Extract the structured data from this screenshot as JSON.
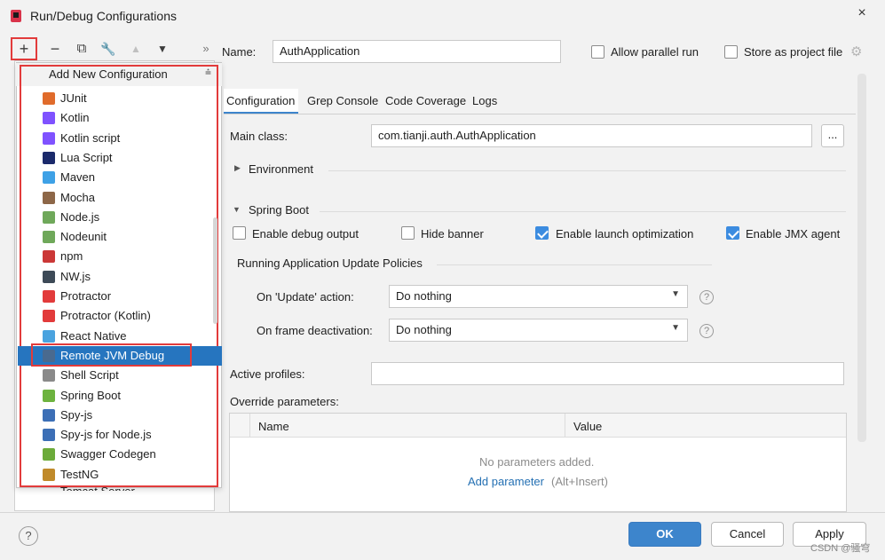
{
  "window": {
    "title": "Run/Debug Configurations",
    "close": "×"
  },
  "toolbar": {
    "add": "+",
    "remove": "−",
    "copy": "⧉",
    "edit": "🔧",
    "up": "▲",
    "down": "▼",
    "more": "»"
  },
  "popup": {
    "header": "Add New Configuration",
    "items": [
      {
        "label": "JUnit",
        "icon": "junit-icon",
        "color": "#e06b2b"
      },
      {
        "label": "Kotlin",
        "icon": "kotlin-icon",
        "color": "#7f52ff"
      },
      {
        "label": "Kotlin script",
        "icon": "kotlin-script-icon",
        "color": "#7f52ff"
      },
      {
        "label": "Lua Script",
        "icon": "lua-icon",
        "color": "#1b2a6b"
      },
      {
        "label": "Maven",
        "icon": "maven-icon",
        "color": "#3ea1e6"
      },
      {
        "label": "Mocha",
        "icon": "mocha-icon",
        "color": "#8d6748"
      },
      {
        "label": "Node.js",
        "icon": "nodejs-icon",
        "color": "#6fa85a"
      },
      {
        "label": "Nodeunit",
        "icon": "nodeunit-icon",
        "color": "#6fa85a"
      },
      {
        "label": "npm",
        "icon": "npm-icon",
        "color": "#cb3837"
      },
      {
        "label": "NW.js",
        "icon": "nwjs-icon",
        "color": "#3d4a57"
      },
      {
        "label": "Protractor",
        "icon": "protractor-icon",
        "color": "#e23b3b"
      },
      {
        "label": "Protractor (Kotlin)",
        "icon": "protractor-kotlin-icon",
        "color": "#e23b3b"
      },
      {
        "label": "React Native",
        "icon": "react-native-icon",
        "color": "#4aa3df"
      },
      {
        "label": "Remote JVM Debug",
        "icon": "remote-debug-icon",
        "color": "#4a6a8f"
      },
      {
        "label": "Shell Script",
        "icon": "shell-script-icon",
        "color": "#8a8a8a"
      },
      {
        "label": "Spring Boot",
        "icon": "spring-boot-icon",
        "color": "#6db33f"
      },
      {
        "label": "Spy-js",
        "icon": "spyjs-icon",
        "color": "#3c6fb6"
      },
      {
        "label": "Spy-js for Node.js",
        "icon": "spyjs-node-icon",
        "color": "#3c6fb6"
      },
      {
        "label": "Swagger Codegen",
        "icon": "swagger-icon",
        "color": "#6cab3a"
      },
      {
        "label": "TestNG",
        "icon": "testng-icon",
        "color": "#c08a2a"
      }
    ],
    "selected_index": 13,
    "partial_item": "Tomcat Server"
  },
  "name_row": {
    "label": "Name:",
    "value": "AuthApplication",
    "allow_parallel": "Allow parallel run",
    "store_project": "Store as project file"
  },
  "tabs": [
    "Configuration",
    "Grep Console",
    "Code Coverage",
    "Logs"
  ],
  "main_class": {
    "label": "Main class:",
    "value": "com.tianji.auth.AuthApplication",
    "browse": "..."
  },
  "environment": "Environment",
  "spring_boot": {
    "header": "Spring Boot",
    "checks": [
      {
        "label": "Enable debug output",
        "checked": false
      },
      {
        "label": "Hide banner",
        "checked": false
      },
      {
        "label": "Enable launch optimization",
        "checked": true
      },
      {
        "label": "Enable JMX agent",
        "checked": true
      }
    ],
    "policies_header": "Running Application Update Policies",
    "on_update": {
      "label": "On 'Update' action:",
      "value": "Do nothing"
    },
    "on_frame": {
      "label": "On frame deactivation:",
      "value": "Do nothing"
    }
  },
  "active_profiles": {
    "label": "Active profiles:",
    "value": ""
  },
  "override": {
    "label": "Override parameters:",
    "col_name": "Name",
    "col_value": "Value",
    "empty": "No parameters added.",
    "add_link": "Add parameter",
    "add_hint": "(Alt+Insert)"
  },
  "footer": {
    "help": "?",
    "ok": "OK",
    "cancel": "Cancel",
    "apply": "Apply"
  },
  "watermark": "CSDN @骚穹"
}
